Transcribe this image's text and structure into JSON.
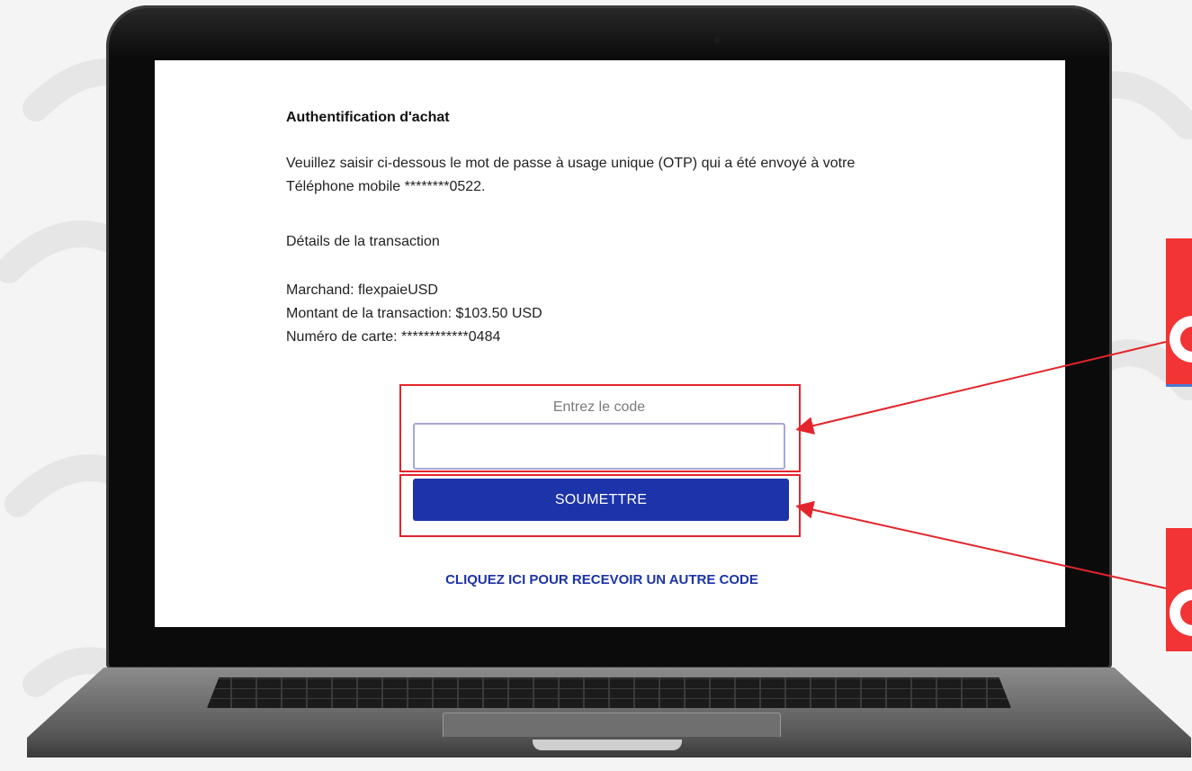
{
  "page": {
    "title": "Authentification d'achat",
    "instruction": "Veuillez saisir ci-dessous le mot de passe à usage unique (OTP) qui a été envoyé à votre Téléphone mobile ********0522.",
    "details_heading": "Détails de la transaction",
    "merchant": "Marchand: flexpaieUSD",
    "amount": "Montant de la transaction: $103.50 USD",
    "card_number": "Numéro de carte: ************0484"
  },
  "form": {
    "code_label": "Entrez le code",
    "code_value": "",
    "submit_label": "SOUMETTRE",
    "resend_link": "CLIQUEZ ICI POUR RECEVOIR UN AUTRE CODE"
  },
  "colors": {
    "primary": "#1c33a9",
    "highlight": "#e3252b",
    "callout": "#f23434"
  },
  "icons": [
    "laptop-icon",
    "annotation-arrow-icon"
  ]
}
